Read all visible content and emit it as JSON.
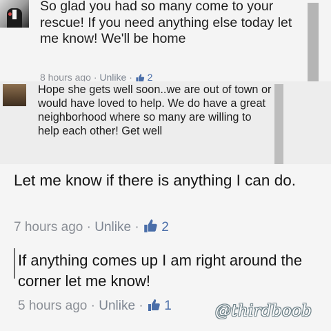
{
  "comments": [
    {
      "text": "So glad you had so many come to your rescue! If you need anything else today let me know! We'll be home",
      "meta": {
        "time": "8 hours ago",
        "sep": " · ",
        "action": "Unlike",
        "sep2": " · ",
        "likes": "2"
      }
    },
    {
      "text": "Hope she gets well soon..we are out of town or would have loved to help. We do have a great neighborhood where so many are willing to help each other! Get well"
    },
    {
      "text": "Let me know if there is anything I can do.",
      "meta": {
        "time": "7 hours ago",
        "sep": " · ",
        "action": "Unlike",
        "sep2": " · ",
        "likes": "2"
      }
    },
    {
      "text": "If anything comes up I am right around the corner let me know!",
      "meta": {
        "time": "5 hours ago",
        "sep": " · ",
        "action": "Unlike",
        "sep2": " · ",
        "likes": "1"
      }
    }
  ],
  "watermark": "@thirdboob",
  "icons": {
    "avatar1": "man-in-suit-avatar",
    "avatar2": "brown-landscape-avatar",
    "like": "thumbs-up-icon"
  },
  "colors": {
    "link_blue": "#4a6ea9",
    "meta_gray": "#8b8f96"
  }
}
